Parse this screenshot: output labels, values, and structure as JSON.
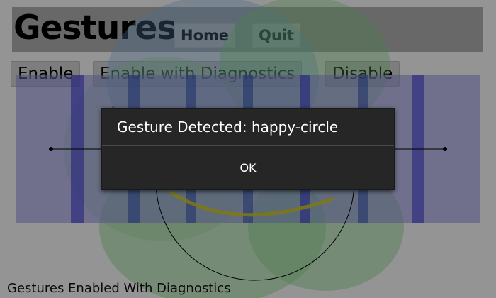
{
  "app": {
    "title": "Gestures",
    "nav": {
      "home_label": "Home",
      "quit_label": "Quit"
    },
    "actions": {
      "enable_label": "Enable",
      "enable_diag_label": "Enable with Diagnostics",
      "disable_label": "Disable"
    },
    "status_text": "Gestures Enabled With Diagnostics"
  },
  "dialog": {
    "message": "Gesture Detected: happy-circle",
    "ok_label": "OK"
  },
  "colors": {
    "stripe_blue": "#2f2fd6",
    "region_blue": "#8f8fe6",
    "blob_green": "#6fc36f",
    "trace_yellow": "#d8d020",
    "dialog_bg": "#262626"
  }
}
